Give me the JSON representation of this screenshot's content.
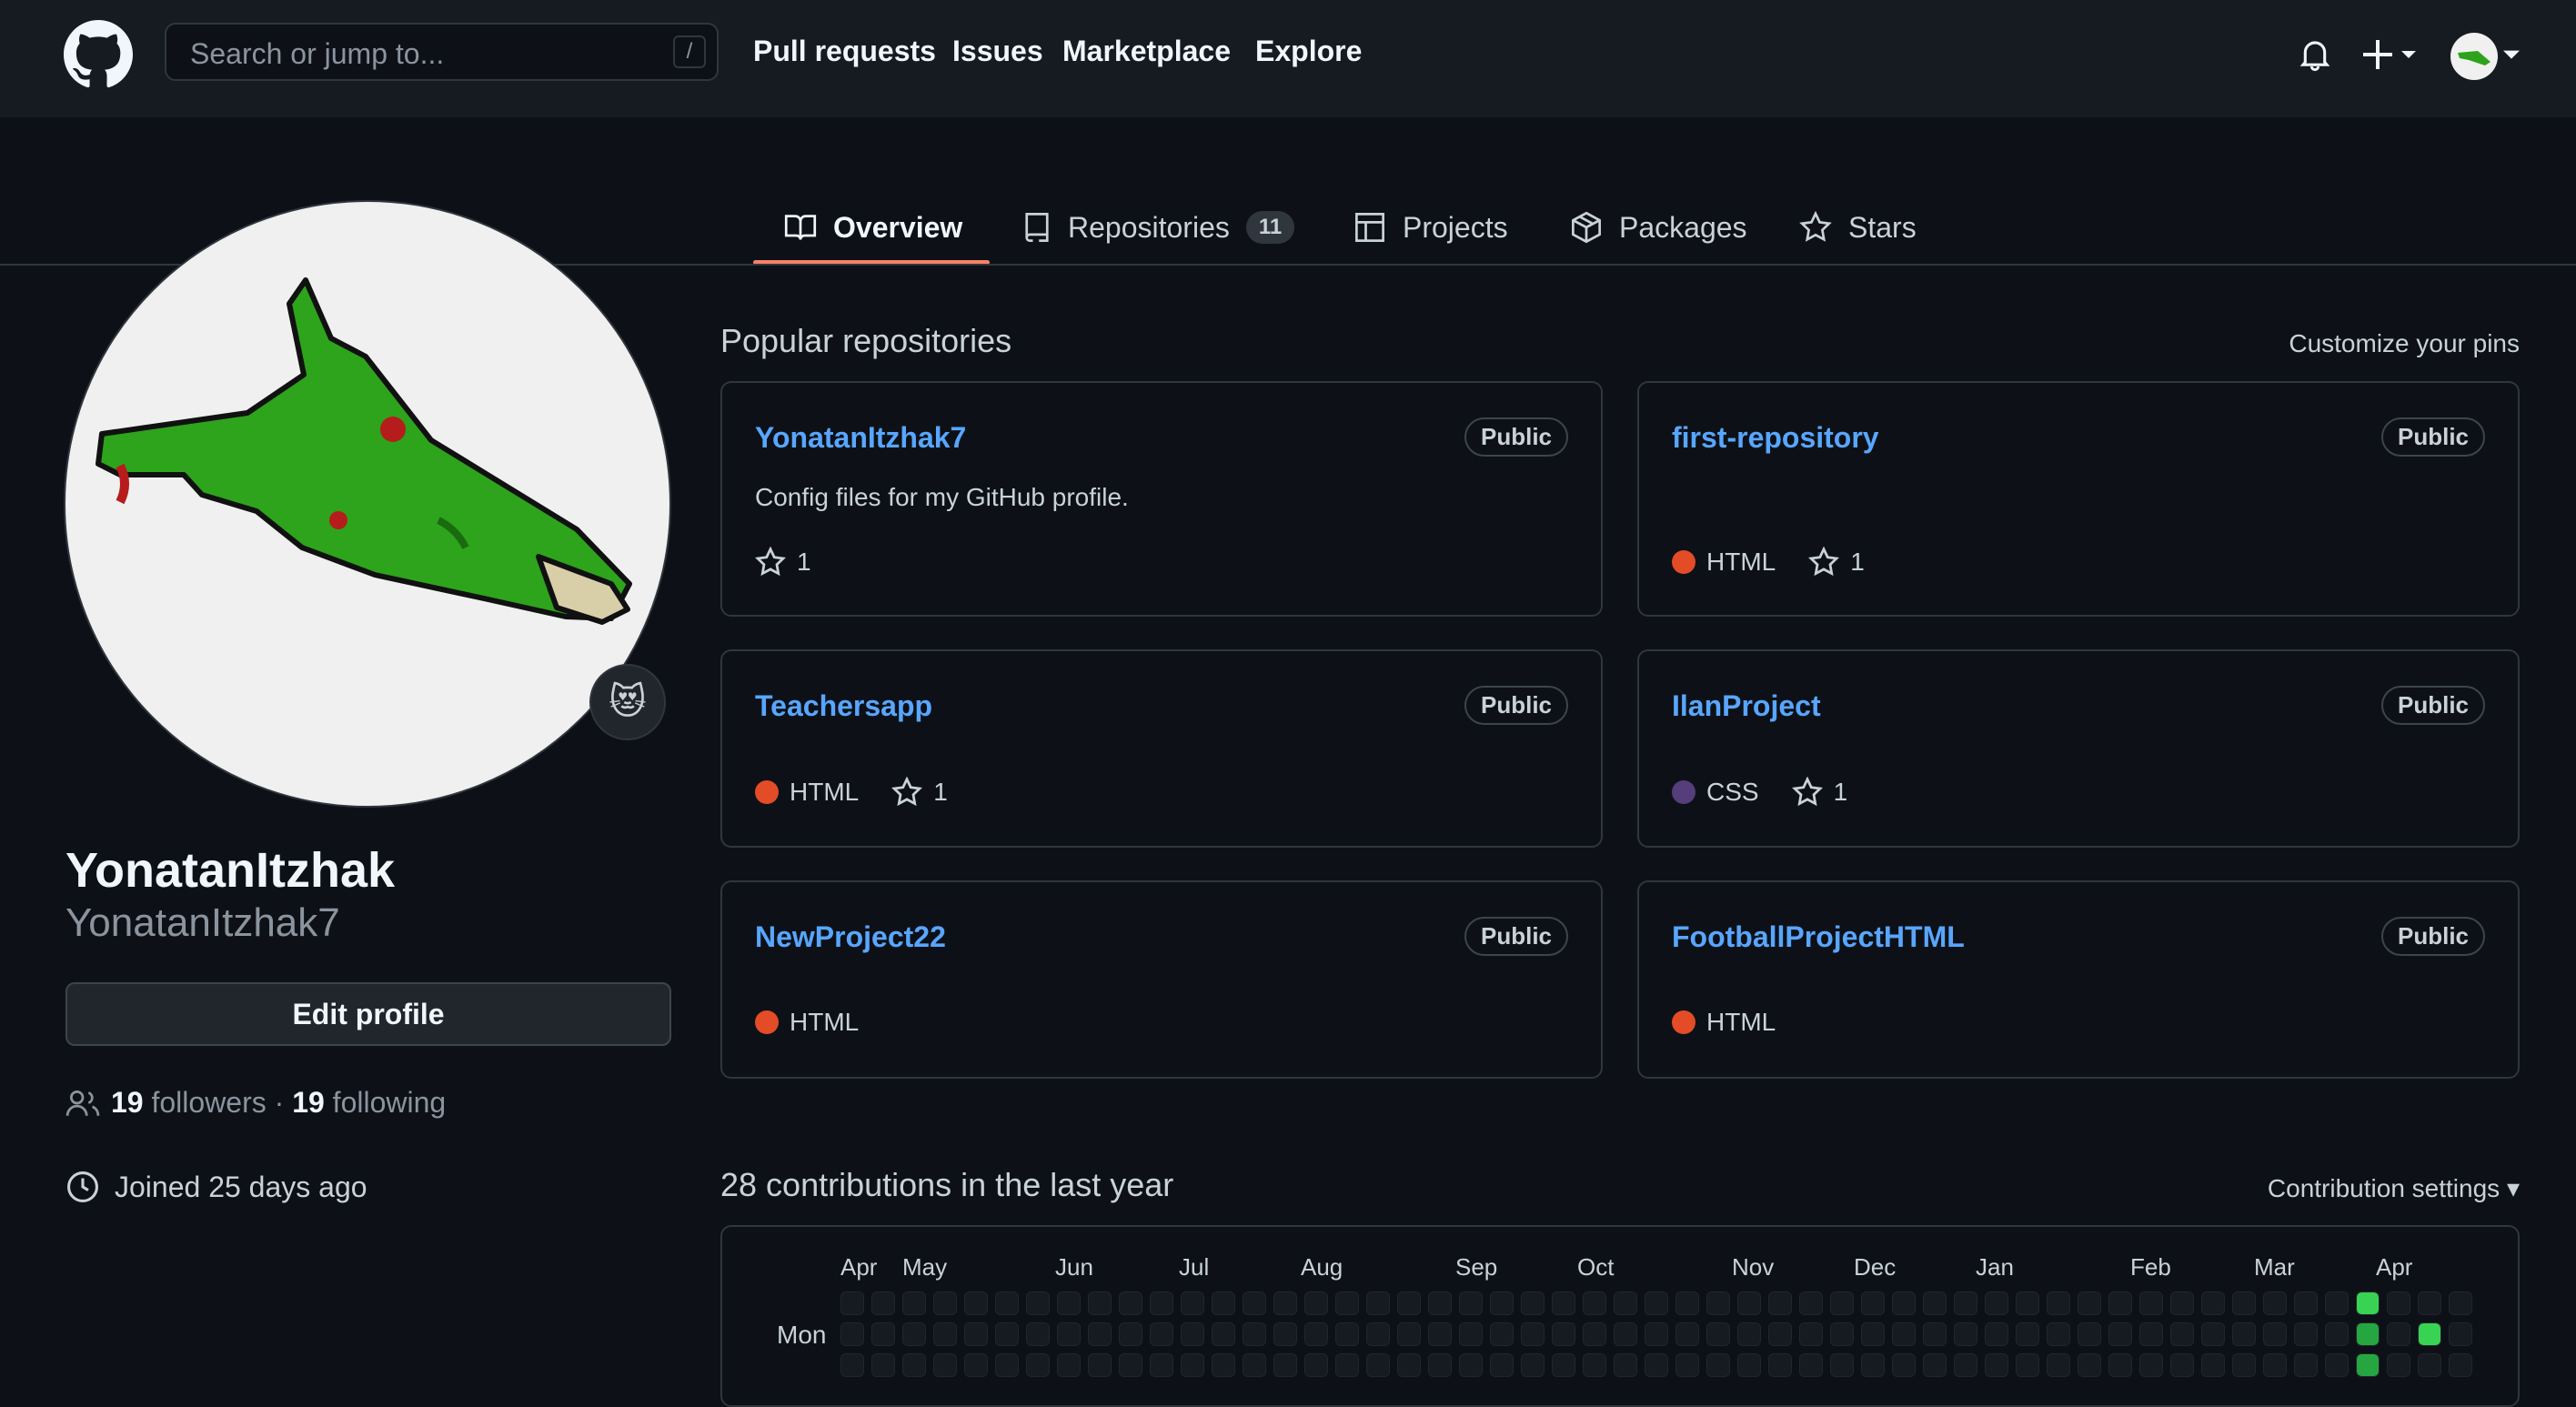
{
  "header": {
    "search_placeholder": "Search or jump to...",
    "search_shortcut": "/",
    "nav": [
      "Pull requests",
      "Issues",
      "Marketplace",
      "Explore"
    ]
  },
  "tabs": [
    {
      "label": "Overview",
      "icon": "book-icon",
      "active": true
    },
    {
      "label": "Repositories",
      "icon": "repo-icon",
      "count": "11"
    },
    {
      "label": "Projects",
      "icon": "table-icon"
    },
    {
      "label": "Packages",
      "icon": "package-icon"
    },
    {
      "label": "Stars",
      "icon": "star-icon"
    }
  ],
  "profile": {
    "name": "YonatanItzhak",
    "login": "YonatanItzhak7",
    "edit_label": "Edit profile",
    "followers": "19",
    "followers_label": "followers",
    "following": "19",
    "following_label": "following",
    "joined": "Joined 25 days ago",
    "status_emoji": "😻"
  },
  "popular": {
    "title": "Popular repositories",
    "customize": "Customize your pins",
    "repos": [
      {
        "name": "YonatanItzhak7",
        "visibility": "Public",
        "description": "Config files for my GitHub profile.",
        "stars": "1"
      },
      {
        "name": "first-repository",
        "visibility": "Public",
        "language": "HTML",
        "lang_color": "#e34c26",
        "stars": "1"
      },
      {
        "name": "Teachersapp",
        "visibility": "Public",
        "language": "HTML",
        "lang_color": "#e34c26",
        "stars": "1"
      },
      {
        "name": "IlanProject",
        "visibility": "Public",
        "language": "CSS",
        "lang_color": "#563d7c",
        "stars": "1"
      },
      {
        "name": "NewProject22",
        "visibility": "Public",
        "language": "HTML",
        "lang_color": "#e34c26"
      },
      {
        "name": "FootballProjectHTML",
        "visibility": "Public",
        "language": "HTML",
        "lang_color": "#e34c26"
      }
    ]
  },
  "contributions": {
    "title": "28 contributions in the last year",
    "settings": "Contribution settings ▾",
    "months": [
      "Apr",
      "May",
      "Jun",
      "Jul",
      "Aug",
      "Sep",
      "Oct",
      "Nov",
      "Dec",
      "Jan",
      "Feb",
      "Mar",
      "Apr"
    ],
    "day_label": "Mon"
  },
  "colors": {
    "accent": "#f78166",
    "link": "#58a6ff",
    "contrib_green": "#39d353",
    "contrib_green_dark": "#26a641"
  }
}
